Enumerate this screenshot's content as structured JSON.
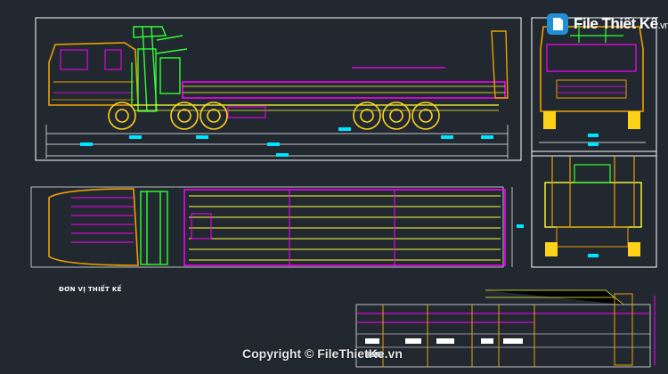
{
  "logo": {
    "name": "File Thiết Kế",
    "suffix": ".vn"
  },
  "labels": {
    "unit": "ĐƠN VỊ THIẾT KẾ"
  },
  "watermark": {
    "copyright": "Copyright © FileThietKe.vn"
  },
  "colors": {
    "background": "#212830",
    "frame": "#ffffff",
    "cabin": "#f0a000",
    "crane": "#33ff33",
    "deck": "#ff00ff",
    "chassis": "#ffff33",
    "dimension": "#00e5ff",
    "wheel": "#ffd21a"
  }
}
